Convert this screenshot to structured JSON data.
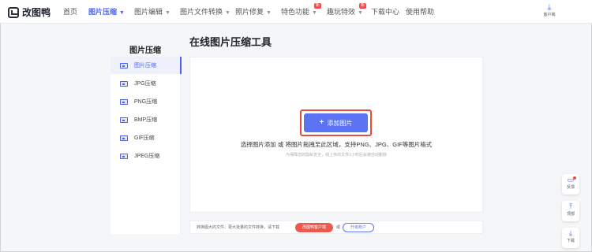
{
  "app": {
    "name": "改图鸭"
  },
  "nav": {
    "items": [
      {
        "label": "首页",
        "active": false,
        "caret": false
      },
      {
        "label": "图片压缩",
        "active": true,
        "caret": true
      },
      {
        "label": "图片编辑",
        "active": false,
        "caret": true
      },
      {
        "label": "图片文件转换",
        "active": false,
        "caret": true
      },
      {
        "label": "照片修复",
        "active": false,
        "caret": true
      },
      {
        "label": "特色功能",
        "active": false,
        "caret": true,
        "badge": "新"
      },
      {
        "label": "趣玩特效",
        "active": false,
        "caret": true,
        "badge": "新"
      },
      {
        "label": "下载中心",
        "active": false,
        "caret": false
      },
      {
        "label": "使用帮助",
        "active": false,
        "caret": false
      }
    ],
    "client_download": "客户端"
  },
  "sidebar": {
    "title": "图片压缩",
    "items": [
      {
        "label": "图片压缩",
        "active": true
      },
      {
        "label": "JPG压缩",
        "active": false
      },
      {
        "label": "PNG压缩",
        "active": false
      },
      {
        "label": "BMP压缩",
        "active": false
      },
      {
        "label": "GIF压缩",
        "active": false
      },
      {
        "label": "JPEG压缩",
        "active": false
      }
    ]
  },
  "main": {
    "title": "在线图片压缩工具",
    "add_button": "添加图片",
    "hint": "选择图片添加 或 将图片拖拽至此区域，支持PNG、JPG、GIF等图片格式",
    "subhint": "为保障您的隐私安全，线上传的文件1小时后会被自动删除"
  },
  "bottom_bar": {
    "text": "转换图大的文件、更大批量的文件转换，请下载",
    "client_button": "改图鸭客户端",
    "or": "或",
    "upgrade_button": "升级账户"
  },
  "float_tools": [
    {
      "label": "反馈",
      "icon": "feedback-icon"
    },
    {
      "label": "顶部",
      "icon": "back-to-top-icon"
    },
    {
      "label": "下载",
      "icon": "download-icon"
    }
  ],
  "colors": {
    "accent": "#4c63f0",
    "badge": "#ef4b4b",
    "highlight_border": "#e74c3c"
  }
}
